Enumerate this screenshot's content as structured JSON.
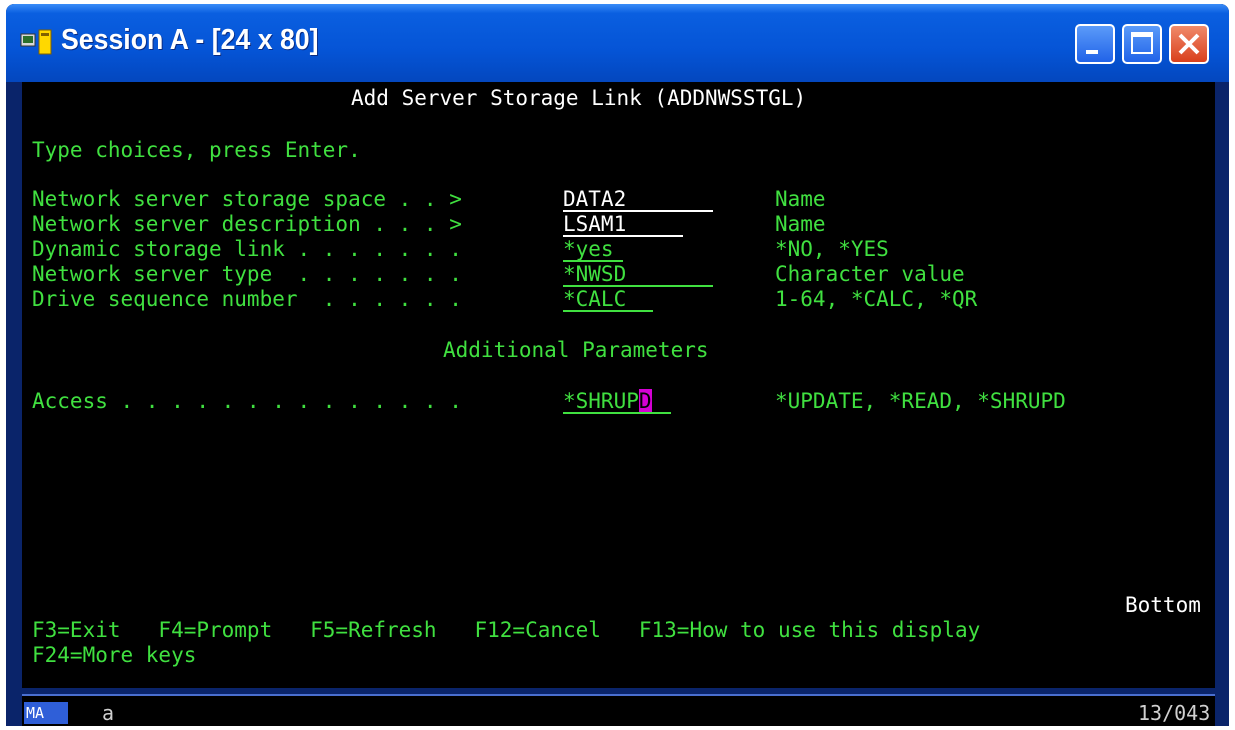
{
  "window": {
    "title": "Session A - [24 x 80]"
  },
  "screen": {
    "heading": "Add Server Storage Link (ADDNWSSTGL)",
    "instruction": "Type choices, press Enter.",
    "prompts": [
      {
        "label": "Network server storage space . . >",
        "value": "DATA2",
        "hint": "Name"
      },
      {
        "label": "Network server description . . . >",
        "value": "LSAM1",
        "hint": "Name"
      },
      {
        "label": "Dynamic storage link . . . . . . .",
        "value": "*yes",
        "hint": "*NO, *YES"
      },
      {
        "label": "Network server type  . . . . . . .",
        "value": "*NWSD",
        "hint": "Character value"
      },
      {
        "label": "Drive sequence number  . . . . . .",
        "value": "*CALC",
        "hint": "1-64, *CALC, *QR"
      }
    ],
    "additional_heading": "Additional Parameters",
    "access": {
      "label": "Access . . . . . . . . . . . . . .",
      "value_main": "*SHRUP",
      "value_cursor": "D",
      "hint": "*UPDATE, *READ, *SHRUPD"
    },
    "more_indicator": "Bottom",
    "fkeys_line1": "F3=Exit   F4=Prompt   F5=Refresh   F12=Cancel   F13=How to use this display",
    "fkeys_line2": "F24=More keys"
  },
  "statusbar": {
    "mode": "MA",
    "session": "a",
    "position": "13/043"
  }
}
